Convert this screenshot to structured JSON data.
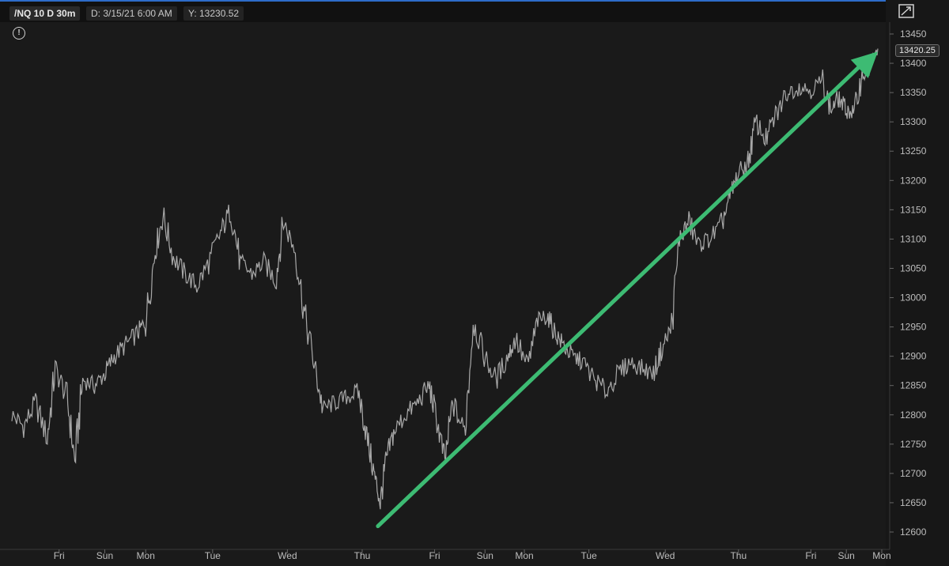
{
  "header": {
    "symbol": "/NQ 10 D 30m",
    "date_label": "D: 3/15/21 6:00 AM",
    "y_label": "Y: 13230.52"
  },
  "chart_data": {
    "type": "line",
    "title": "",
    "xlabel": "",
    "ylabel": "",
    "ylim": [
      12585,
      13470
    ],
    "y_ticks": [
      12600,
      12650,
      12700,
      12750,
      12800,
      12850,
      12900,
      12950,
      13000,
      13050,
      13100,
      13150,
      13200,
      13250,
      13300,
      13350,
      13400,
      13450
    ],
    "x_ticks": [
      {
        "label": "Fri",
        "x": 0.06
      },
      {
        "label": "Sun",
        "x": 0.118
      },
      {
        "label": "Mon",
        "x": 0.17
      },
      {
        "label": "Tue",
        "x": 0.255
      },
      {
        "label": "Wed",
        "x": 0.35
      },
      {
        "label": "Thu",
        "x": 0.445
      },
      {
        "label": "Fri",
        "x": 0.537
      },
      {
        "label": "Sun",
        "x": 0.601
      },
      {
        "label": "Mon",
        "x": 0.651
      },
      {
        "label": "Tue",
        "x": 0.733
      },
      {
        "label": "Wed",
        "x": 0.83
      },
      {
        "label": "Thu",
        "x": 0.923
      },
      {
        "label": "Fri",
        "x": 1.015
      },
      {
        "label": "Sun",
        "x": 1.06
      },
      {
        "label": "Mon",
        "x": 1.105
      }
    ],
    "series": [
      {
        "values": [
          [
            0.0,
            12800
          ],
          [
            0.015,
            12780
          ],
          [
            0.03,
            12820
          ],
          [
            0.045,
            12760
          ],
          [
            0.055,
            12880
          ],
          [
            0.07,
            12830
          ],
          [
            0.08,
            12720
          ],
          [
            0.09,
            12860
          ],
          [
            0.105,
            12850
          ],
          [
            0.118,
            12870
          ],
          [
            0.13,
            12900
          ],
          [
            0.145,
            12920
          ],
          [
            0.16,
            12940
          ],
          [
            0.17,
            12960
          ],
          [
            0.182,
            13080
          ],
          [
            0.192,
            13140
          ],
          [
            0.205,
            13070
          ],
          [
            0.22,
            13040
          ],
          [
            0.235,
            13020
          ],
          [
            0.25,
            13060
          ],
          [
            0.265,
            13110
          ],
          [
            0.278,
            13150
          ],
          [
            0.29,
            13060
          ],
          [
            0.305,
            13040
          ],
          [
            0.32,
            13060
          ],
          [
            0.335,
            13030
          ],
          [
            0.345,
            13130
          ],
          [
            0.36,
            13080
          ],
          [
            0.372,
            12970
          ],
          [
            0.385,
            12880
          ],
          [
            0.395,
            12810
          ],
          [
            0.41,
            12820
          ],
          [
            0.425,
            12830
          ],
          [
            0.44,
            12840
          ],
          [
            0.45,
            12770
          ],
          [
            0.46,
            12700
          ],
          [
            0.468,
            12650
          ],
          [
            0.475,
            12720
          ],
          [
            0.485,
            12770
          ],
          [
            0.5,
            12800
          ],
          [
            0.515,
            12820
          ],
          [
            0.53,
            12850
          ],
          [
            0.54,
            12790
          ],
          [
            0.55,
            12720
          ],
          [
            0.56,
            12820
          ],
          [
            0.575,
            12770
          ],
          [
            0.586,
            12960
          ],
          [
            0.6,
            12900
          ],
          [
            0.615,
            12860
          ],
          [
            0.63,
            12900
          ],
          [
            0.64,
            12930
          ],
          [
            0.655,
            12880
          ],
          [
            0.668,
            12960
          ],
          [
            0.68,
            12970
          ],
          [
            0.69,
            12940
          ],
          [
            0.7,
            12920
          ],
          [
            0.712,
            12900
          ],
          [
            0.725,
            12890
          ],
          [
            0.74,
            12860
          ],
          [
            0.755,
            12840
          ],
          [
            0.77,
            12870
          ],
          [
            0.785,
            12890
          ],
          [
            0.8,
            12880
          ],
          [
            0.815,
            12870
          ],
          [
            0.825,
            12910
          ],
          [
            0.838,
            12950
          ],
          [
            0.848,
            13100
          ],
          [
            0.86,
            13130
          ],
          [
            0.872,
            13090
          ],
          [
            0.885,
            13100
          ],
          [
            0.9,
            13120
          ],
          [
            0.912,
            13170
          ],
          [
            0.922,
            13210
          ],
          [
            0.935,
            13230
          ],
          [
            0.945,
            13300
          ],
          [
            0.958,
            13270
          ],
          [
            0.97,
            13310
          ],
          [
            0.985,
            13350
          ],
          [
            1.0,
            13360
          ],
          [
            1.015,
            13355
          ],
          [
            1.03,
            13370
          ],
          [
            1.04,
            13320
          ],
          [
            1.05,
            13340
          ],
          [
            1.06,
            13320
          ],
          [
            1.07,
            13315
          ],
          [
            1.08,
            13380
          ],
          [
            1.09,
            13390
          ],
          [
            1.1,
            13425
          ]
        ]
      }
    ],
    "annotations": [
      {
        "type": "arrow",
        "color": "#3dbb73",
        "from": [
          0.465,
          12610
        ],
        "to": [
          1.1,
          13420
        ]
      }
    ],
    "last_price": "13420.25",
    "grid": false,
    "legend": "none"
  }
}
